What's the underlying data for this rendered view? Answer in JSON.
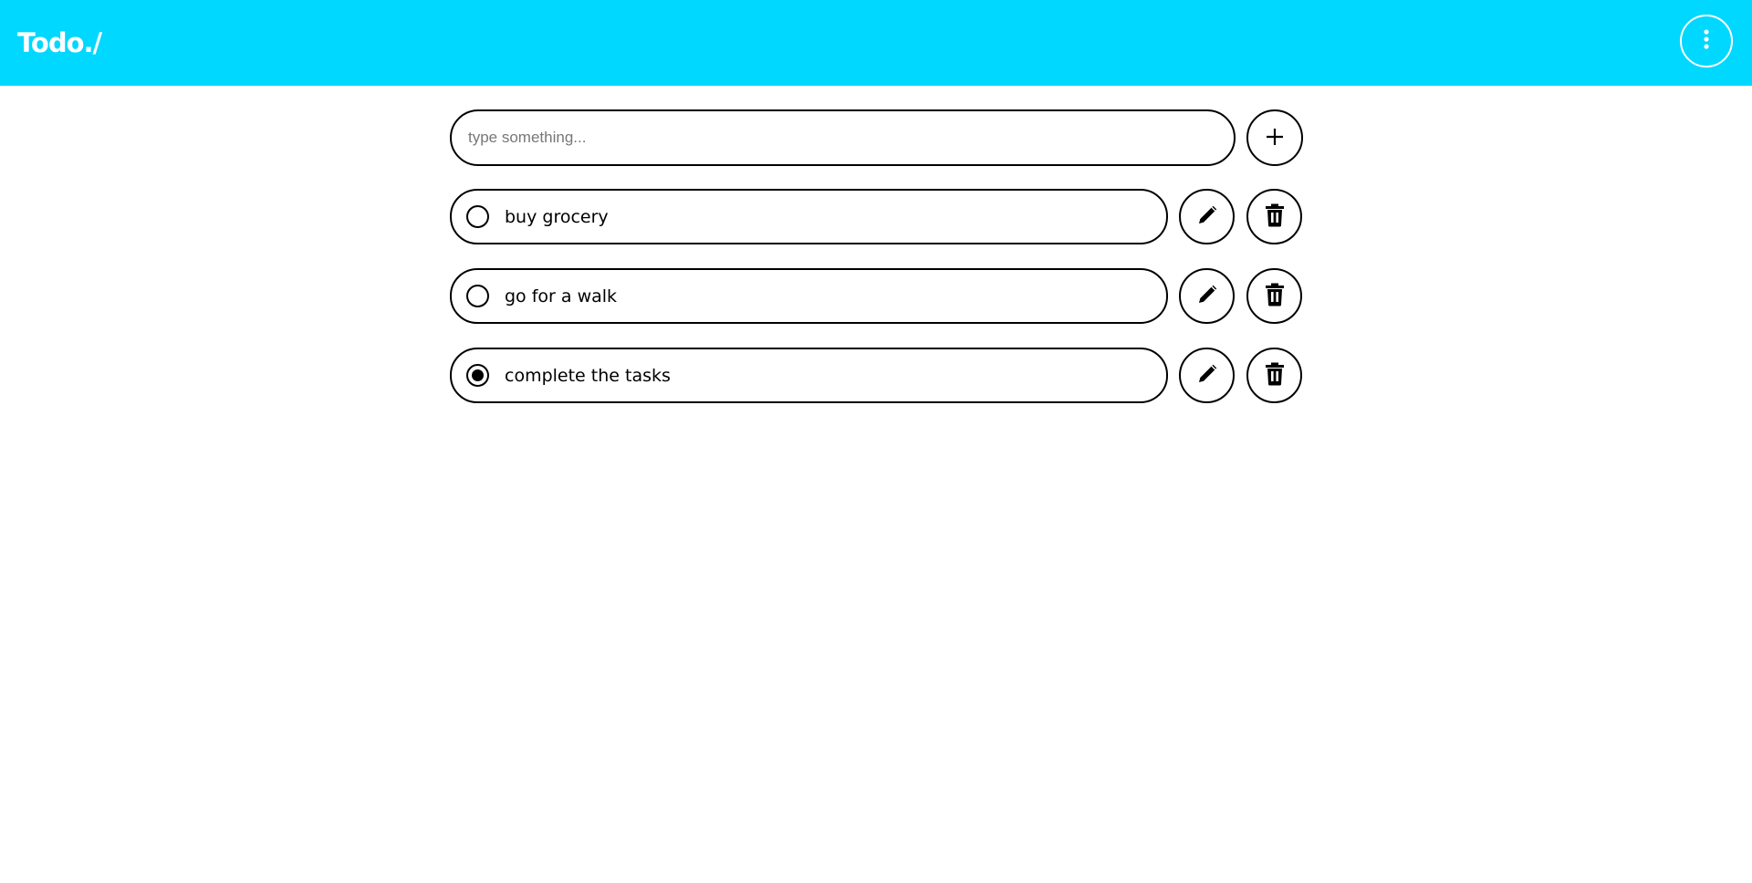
{
  "header": {
    "brand": "Todo./",
    "menu_icon": "more-vertical-icon"
  },
  "composer": {
    "placeholder": "type something...",
    "value": "",
    "add_icon": "plus-icon"
  },
  "todos": [
    {
      "text": "buy grocery",
      "completed": false
    },
    {
      "text": "go for a walk",
      "completed": false
    },
    {
      "text": "complete the tasks",
      "completed": true
    }
  ],
  "icons": {
    "edit": "pencil-icon",
    "delete": "trash-icon"
  },
  "colors": {
    "header_bg": "#00d8ff",
    "brand_text": "#ffffff",
    "border": "#000000"
  }
}
